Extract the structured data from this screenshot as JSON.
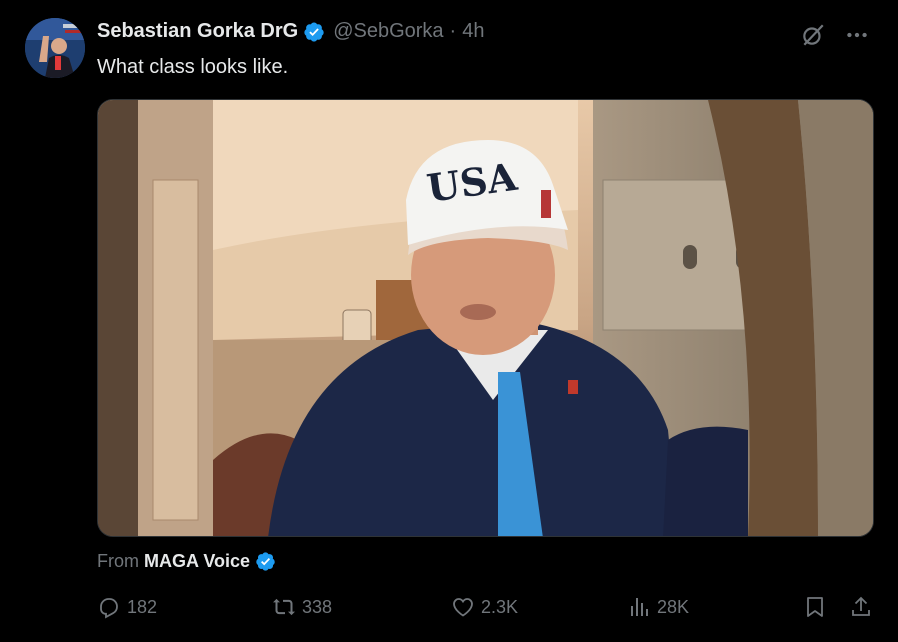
{
  "tweet": {
    "display_name": "Sebastian Gorka DrG",
    "handle": "@SebGorka",
    "separator": "·",
    "time": "4h",
    "text": "What class looks like.",
    "media_alt": "Video frame: man in white USA cap, dark suit and blue tie inside an aircraft cabin"
  },
  "source": {
    "prefix": "From",
    "name": "MAGA Voice"
  },
  "actions": {
    "replies": "182",
    "reposts": "338",
    "likes": "2.3K",
    "views": "28K"
  },
  "icons": {
    "verified": "verified-badge-icon",
    "grok": "grok-icon",
    "more": "more-icon",
    "reply": "reply-icon",
    "repost": "repost-icon",
    "like": "heart-icon",
    "views": "views-icon",
    "bookmark": "bookmark-icon",
    "share": "share-icon"
  },
  "colors": {
    "background": "#000000",
    "text": "#e7e9ea",
    "muted": "#71767b",
    "verified": "#1d9bf0"
  }
}
